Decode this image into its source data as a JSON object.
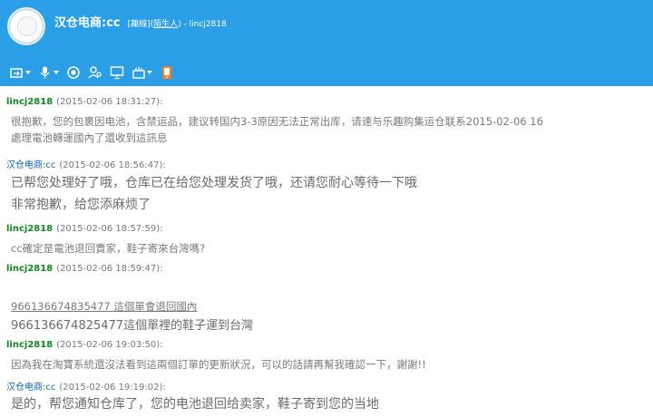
{
  "header": {
    "name": "汉仓电商:cc",
    "status": "[離線](",
    "group": "陌生人",
    "account": ") - lincj2818"
  },
  "toolbar": {
    "icons": [
      "folder-transfer-icon",
      "microphone-icon",
      "record-icon",
      "people-icon",
      "screen-share-icon",
      "apps-icon",
      "phone-transfer-icon"
    ]
  },
  "messages": [
    {
      "name": "lincj2818",
      "ts": "(2015-02-06 18:31:27):",
      "lines": [
        "很抱歉，您的包裹因电池，含禁运品，建议转国内3-3原因无法正常出库，请速与乐趣购集运仓联系2015-02-06 16",
        "處理電池轉運國內了還收到這訊息"
      ]
    },
    {
      "name": "汉仓电商:cc",
      "ts": "(2015-02-06 18:56:47):",
      "lines": [
        "已帮您处理好了哦，仓库已在给您处理发货了哦，还请您耐心等待一下哦",
        "非常抱歉，给您添麻烦了"
      ]
    },
    {
      "name": "lincj2818",
      "ts": "(2015-02-06 18:57:59):",
      "lines": [
        "cc確定是電池退回賣家，鞋子寄來台灣嗎?"
      ]
    },
    {
      "name": "lincj2818",
      "ts": "(2015-02-06 18:59:47):",
      "lines": [
        "",
        "966136674835477 這個單會退回國內",
        "966136674825477這個單裡的鞋子運到台灣"
      ]
    },
    {
      "name": "lincj2818",
      "ts": "(2015-02-06 19:03:50):",
      "lines": [
        "因為我在淘寶系統還沒法看到這兩個訂單的更新狀況，可以的話請再幫我確認一下，謝謝!!"
      ]
    },
    {
      "name": "汉仓电商:cc",
      "ts": "(2015-02-06 19:19:02):",
      "lines": [
        "是的，帮您通知仓库了，您的电池退回给卖家，鞋子寄到您的当地"
      ]
    }
  ],
  "colors": {
    "header": "#2a9ee6",
    "sender_green": "#0b8a1f",
    "sender_blue": "#0d63c6"
  }
}
